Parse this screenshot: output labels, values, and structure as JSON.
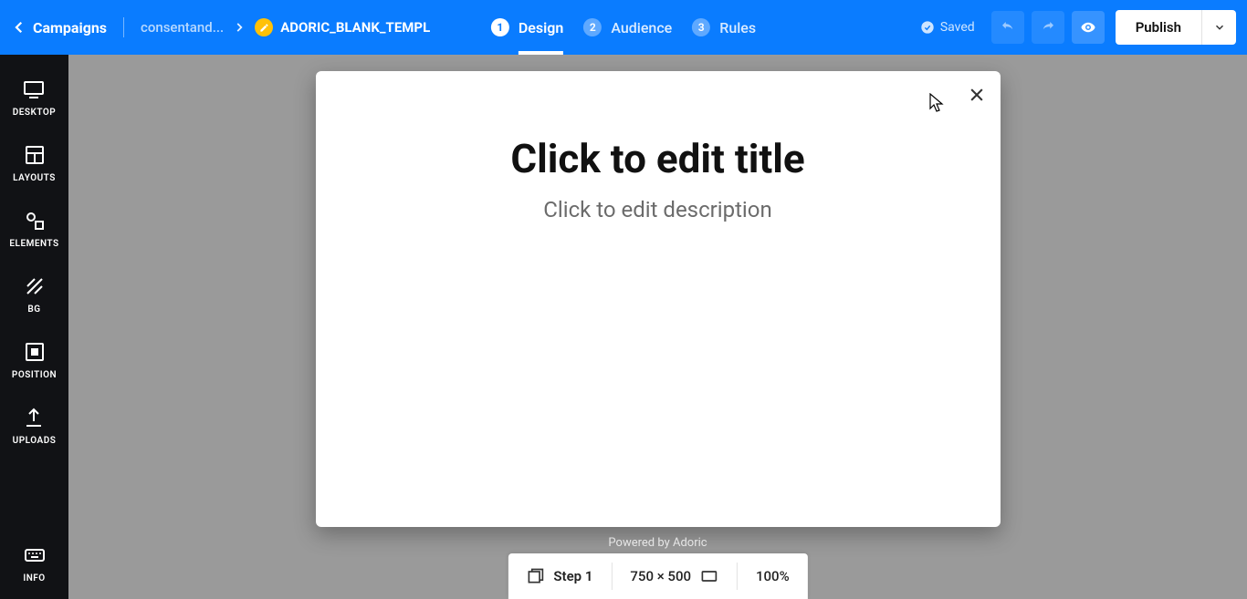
{
  "header": {
    "campaigns_label": "Campaigns",
    "breadcrumb_prev": "consentand...",
    "breadcrumb_current": "ADORIC_BLANK_TEMPL",
    "saved_label": "Saved",
    "publish_label": "Publish",
    "steps": [
      {
        "num": "1",
        "label": "Design"
      },
      {
        "num": "2",
        "label": "Audience"
      },
      {
        "num": "3",
        "label": "Rules"
      }
    ]
  },
  "sidebar": {
    "items": [
      {
        "label": "DESKTOP"
      },
      {
        "label": "LAYOUTS"
      },
      {
        "label": "ELEMENTS"
      },
      {
        "label": "BG"
      },
      {
        "label": "POSITION"
      },
      {
        "label": "UPLOADS"
      },
      {
        "label": "INFO"
      }
    ]
  },
  "popup": {
    "title": "Click to edit title",
    "description": "Click to edit description"
  },
  "footer": {
    "powered": "Powered by Adoric",
    "step_label": "Step 1",
    "dimensions": "750 × 500",
    "zoom": "100%"
  }
}
